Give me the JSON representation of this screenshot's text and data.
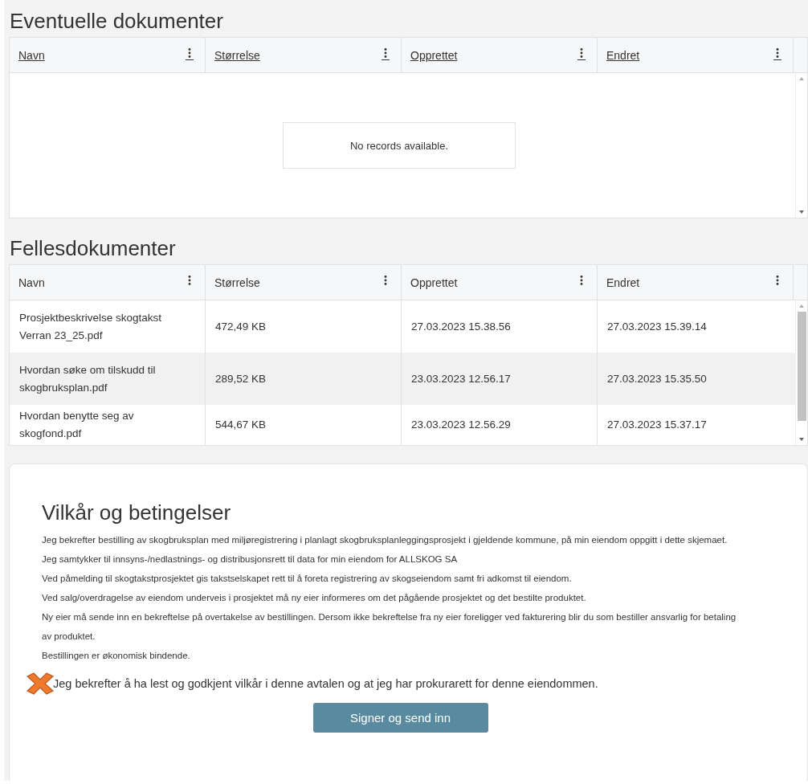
{
  "tables": [
    {
      "title": "Eventuelle dokumenter",
      "sortable": true,
      "columns": [
        "Navn",
        "Størrelse",
        "Opprettet",
        "Endret"
      ],
      "empty_message": "No records available."
    },
    {
      "title": "Fellesdokumenter",
      "sortable": false,
      "columns": [
        "Navn",
        "Størrelse",
        "Opprettet",
        "Endret"
      ],
      "rows": [
        {
          "cells": [
            "Prosjektbeskrivelse skogtakst Verran 23_25.pdf",
            "472,49 KB",
            "27.03.2023 15.38.56",
            "27.03.2023 15.39.14"
          ],
          "selected": false
        },
        {
          "cells": [
            "Hvordan søke om tilskudd til skogbruksplan.pdf",
            "289,52 KB",
            "23.03.2023 12.56.17",
            "27.03.2023 15.35.50"
          ],
          "selected": true
        },
        {
          "cells": [
            "Hvordan benytte seg av skogfond.pdf",
            "544,67 KB",
            "23.03.2023 12.56.29",
            "27.03.2023 15.37.17"
          ],
          "selected": false
        }
      ]
    }
  ],
  "terms": {
    "title": "Vilkår og betingelser",
    "paragraphs": [
      "Jeg bekrefter bestilling av skogbruksplan med miljøregistrering i planlagt skogbruksplanleggingsprosjekt i gjeldende kommune, på min eiendom oppgitt i dette skjemaet. Jeg samtykker til innsyns-/nedlastnings- og distribusjonsrett til data for min eiendom for ALLSKOG SA",
      "Ved påmelding til skogtakstprosjektet gis takstselskapet rett til å foreta registrering av skogseiendom samt fri adkomst til eiendom.",
      "Ved salg/overdragelse av eiendom underveis i prosjektet må ny eier informeres om det pågående prosjektet og det bestilte produktet.",
      "Ny eier må sende inn en bekreftelse på overtakelse av bestillingen. Dersom ikke bekreftelse fra ny eier foreligger ved fakturering blir du som bestiller  ansvarlig for betaling av produktet.",
      "Bestillingen er økonomisk bindende."
    ],
    "confirm_label": "Jeg bekrefter å ha lest og godkjent vilkår i denne avtalen og at jeg har prokurarett for denne eiendommen.",
    "button": "Signer og send inn"
  }
}
